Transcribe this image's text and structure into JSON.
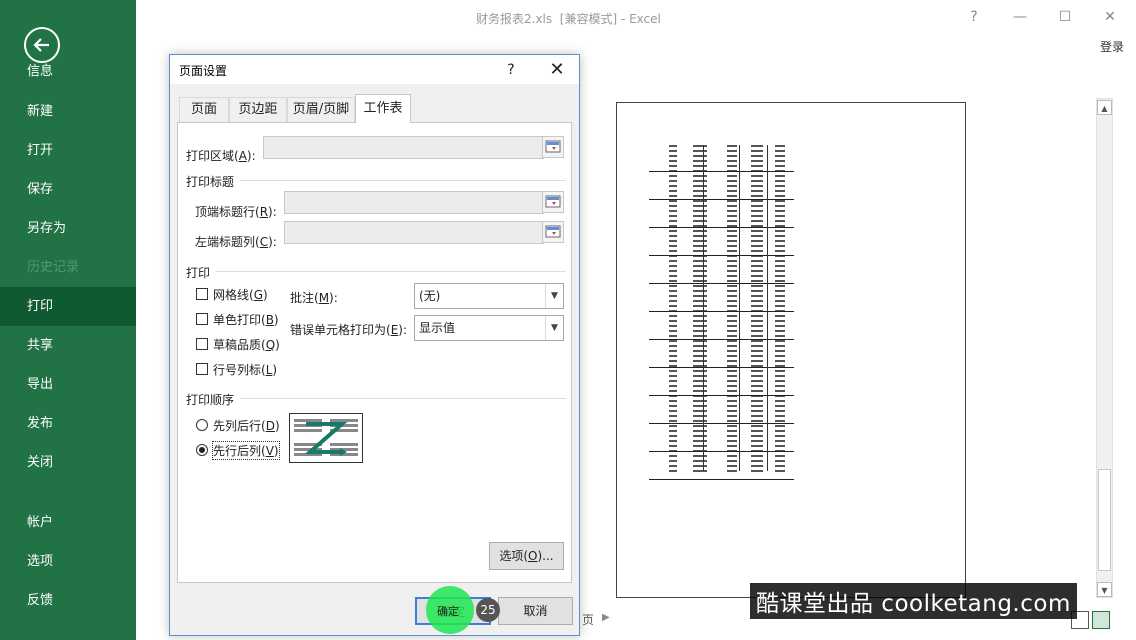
{
  "window": {
    "title": "财务报表2.xls  [兼容模式] - Excel",
    "help": "?",
    "minimize": "—",
    "maximize": "☐",
    "close": "✕",
    "signin": "登录"
  },
  "sidebar": {
    "back_icon": "back-arrow-icon",
    "items": [
      {
        "label": "信息",
        "state": "normal"
      },
      {
        "label": "新建",
        "state": "normal"
      },
      {
        "label": "打开",
        "state": "normal"
      },
      {
        "label": "保存",
        "state": "normal"
      },
      {
        "label": "另存为",
        "state": "normal"
      },
      {
        "label": "历史记录",
        "state": "disabled"
      },
      {
        "label": "打印",
        "state": "active"
      },
      {
        "label": "共享",
        "state": "normal"
      },
      {
        "label": "导出",
        "state": "normal"
      },
      {
        "label": "发布",
        "state": "normal"
      },
      {
        "label": "关闭",
        "state": "normal"
      },
      {
        "label": "帐户",
        "state": "normal"
      },
      {
        "label": "选项",
        "state": "normal"
      },
      {
        "label": "反馈",
        "state": "normal"
      }
    ]
  },
  "dialog": {
    "title": "页面设置",
    "help": "?",
    "close": "✕",
    "tabs": [
      {
        "label": "页面",
        "active": false
      },
      {
        "label": "页边距",
        "active": false
      },
      {
        "label": "页眉/页脚",
        "active": false
      },
      {
        "label": "工作表",
        "active": true
      }
    ],
    "print_area": {
      "label": "打印区域(",
      "key": "A",
      "suffix": "):",
      "value": ""
    },
    "print_titles": {
      "section": "打印标题",
      "rows": {
        "label": "顶端标题行(",
        "key": "R",
        "suffix": "):",
        "value": ""
      },
      "cols": {
        "label": "左端标题列(",
        "key": "C",
        "suffix": "):",
        "value": ""
      }
    },
    "print": {
      "section": "打印",
      "gridlines": {
        "label": "网格线(",
        "key": "G",
        "suffix": ")",
        "checked": false
      },
      "mono": {
        "label": "单色打印(",
        "key": "B",
        "suffix": ")",
        "checked": false
      },
      "draft": {
        "label": "草稿品质(",
        "key": "Q",
        "suffix": ")",
        "checked": false
      },
      "headings": {
        "label": "行号列标(",
        "key": "L",
        "suffix": ")",
        "checked": false
      },
      "comments": {
        "label": "批注(",
        "key": "M",
        "suffix": "):",
        "value": "(无)"
      },
      "errors": {
        "label": "错误单元格打印为(",
        "key": "E",
        "suffix": "):",
        "value": "显示值"
      }
    },
    "order": {
      "section": "打印顺序",
      "down_then_over": {
        "label": "先列后行(",
        "key": "D",
        "suffix": ")",
        "checked": false
      },
      "over_then_down": {
        "label": "先行后列(",
        "key": "V",
        "suffix": ")",
        "checked": true
      }
    },
    "options_btn": {
      "label": "选项(",
      "key": "O",
      "suffix": ")..."
    },
    "ok_btn": "确定",
    "cancel_btn": "取消"
  },
  "click_count": "25",
  "preview": {
    "page_label": "页"
  },
  "watermark": "酷课堂出品 coolketang.com",
  "colors": {
    "sidebar": "#217346",
    "sidebar_active": "#0f5a31",
    "accent_focus": "#3c7fd6",
    "click_highlight": "#1ee650"
  }
}
